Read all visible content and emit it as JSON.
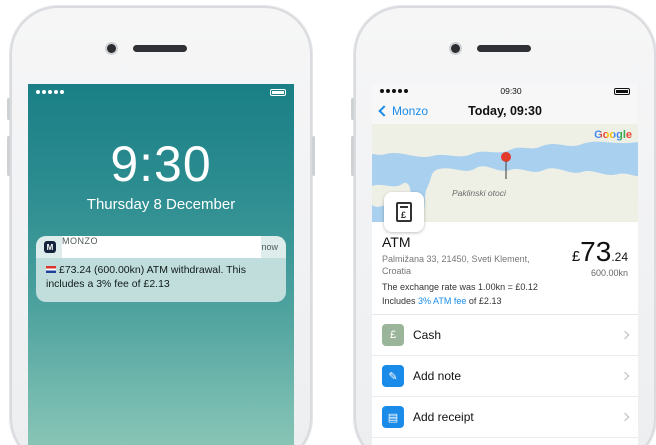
{
  "lock_screen": {
    "time": "9:30",
    "date": "Thursday 8 December",
    "notification": {
      "app_name": "MONZO",
      "app_icon_letter": "M",
      "timestamp": "now",
      "message": "£73.24 (600.00kn) ATM withdrawal. This includes a 3% fee of £2.13"
    }
  },
  "app_screen": {
    "status_time": "09:30",
    "back_label": "Monzo",
    "title": "Today, 09:30",
    "map": {
      "place_label": "Paklinski otoci",
      "google_logo": "Google"
    },
    "merchant_icon_glyph": "£",
    "merchant": "ATM",
    "amount_currency": "£",
    "amount_major": "73",
    "amount_minor": ".24",
    "amount_local": "600.00kn",
    "address": "Palmižana 33, 21450, Sveti Klement, Croatia",
    "exchange_rate": "The exchange rate was 1.00kn = £0.12",
    "fee_prefix": "Includes",
    "fee_link": "3% ATM fee",
    "fee_suffix": "of £2.13",
    "rows": [
      {
        "label": "Cash",
        "icon": "cash-icon",
        "glyph": "£",
        "color": "#9bb59a"
      },
      {
        "label": "Add note",
        "icon": "pencil-icon",
        "glyph": "✎",
        "color": "#1a8be8"
      },
      {
        "label": "Add receipt",
        "icon": "receipt-icon",
        "glyph": "▤",
        "color": "#1a8be8"
      }
    ]
  }
}
